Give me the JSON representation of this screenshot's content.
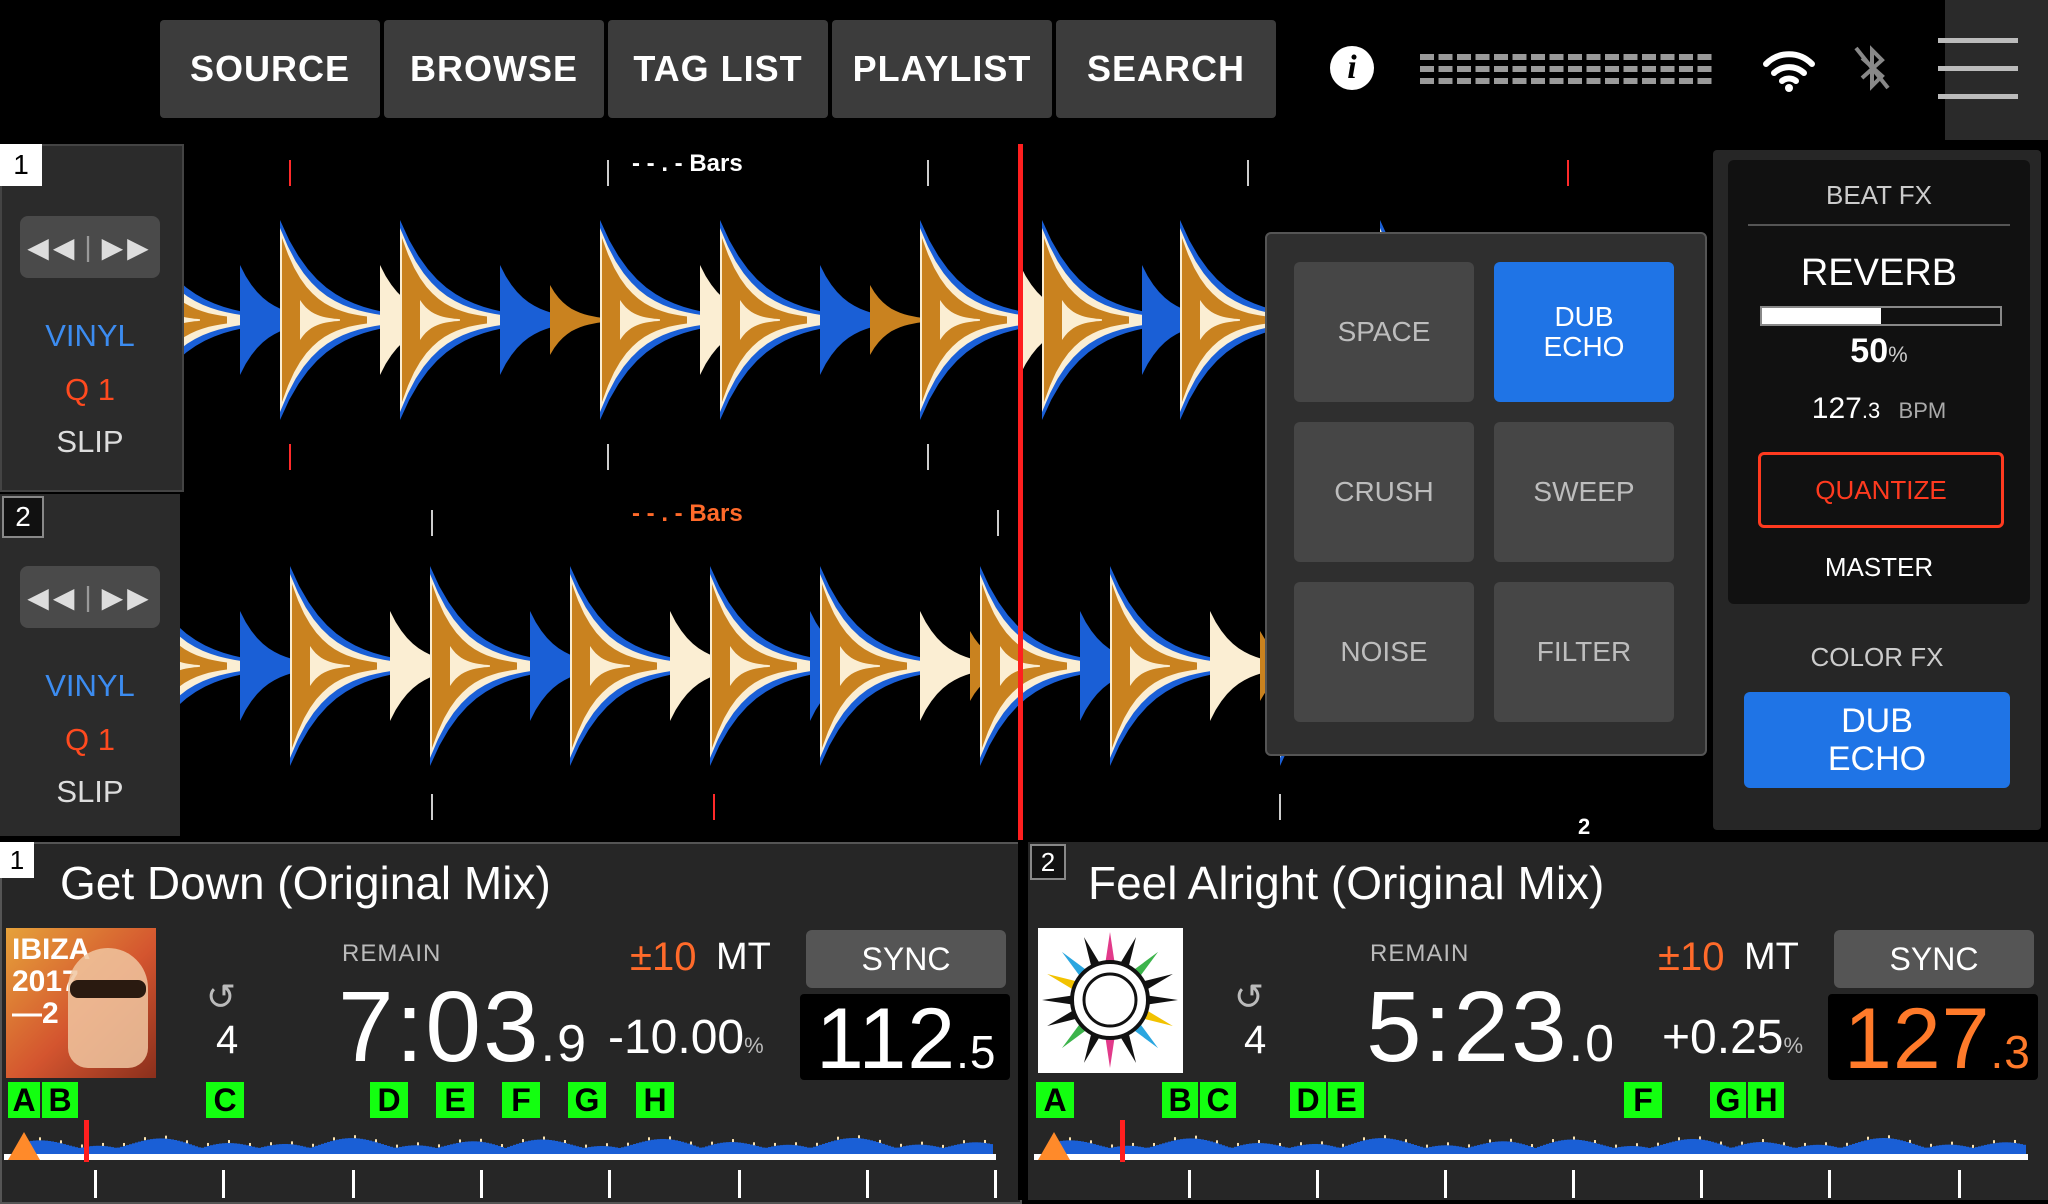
{
  "top_nav": [
    "SOURCE",
    "BROWSE",
    "TAG LIST",
    "PLAYLIST",
    "SEARCH"
  ],
  "icons": {
    "info": "info-icon",
    "wifi": "wifi-icon",
    "bluetooth": "bluetooth-icon",
    "menu": "hamburger-menu-icon"
  },
  "decks": [
    {
      "number": "1",
      "mode": {
        "vinyl": "VINYL",
        "quantize": "Q 1",
        "slip": "SLIP"
      },
      "bars_label": "- - . - Bars",
      "title": "Get Down (Original Mix)",
      "remain_label": "REMAIN",
      "time_main": "7:03",
      "time_frac": ".9",
      "loop_beats": "4",
      "tempo_range": "±10",
      "mt": "MT",
      "tempo_pct": "-10.00",
      "pct_sign": "%",
      "sync": "SYNC",
      "bpm_int": "112",
      "bpm_frac": ".5",
      "bpm_color": "#ffffff",
      "art_text": "IBIZA 2017 —2",
      "cues": [
        "A",
        "B",
        "C",
        "D",
        "E",
        "F",
        "G",
        "H"
      ]
    },
    {
      "number": "2",
      "mode": {
        "vinyl": "VINYL",
        "quantize": "Q 1",
        "slip": "SLIP"
      },
      "bars_label": "- - . - Bars",
      "title": "Feel Alright (Original Mix)",
      "remain_label": "REMAIN",
      "time_main": "5:23",
      "time_frac": ".0",
      "loop_beats": "4",
      "tempo_range": "±10",
      "mt": "MT",
      "tempo_pct": "+0.25",
      "pct_sign": "%",
      "sync": "SYNC",
      "bpm_int": "127",
      "bpm_frac": ".3",
      "bpm_color": "#ff7a2a",
      "cues": [
        "A",
        "B",
        "C",
        "D",
        "E",
        "F",
        "G",
        "H"
      ]
    }
  ],
  "waveform_marker_number": "2",
  "fx_popup": [
    {
      "label": "SPACE",
      "active": false
    },
    {
      "label": "DUB\nECHO",
      "active": true
    },
    {
      "label": "CRUSH",
      "active": false
    },
    {
      "label": "SWEEP",
      "active": false
    },
    {
      "label": "NOISE",
      "active": false
    },
    {
      "label": "FILTER",
      "active": false
    }
  ],
  "beat_fx": {
    "header": "BEAT FX",
    "effect": "REVERB",
    "level_pct": "50",
    "level_unit": "%",
    "level_fraction": 0.5,
    "bpm_int": "127",
    "bpm_frac": ".3",
    "bpm_unit": "BPM",
    "quantize": "QUANTIZE",
    "channel": "MASTER"
  },
  "color_fx": {
    "header": "COLOR FX",
    "effect_line1": "DUB",
    "effect_line2": "ECHO"
  },
  "colors": {
    "accent_blue": "#1f74e6",
    "accent_orange": "#ff6a2a",
    "cue_green": "#13ff10",
    "wave_blue": "#1a5fd6",
    "wave_orange": "#c9821f",
    "wave_cream": "#fbeed3"
  }
}
